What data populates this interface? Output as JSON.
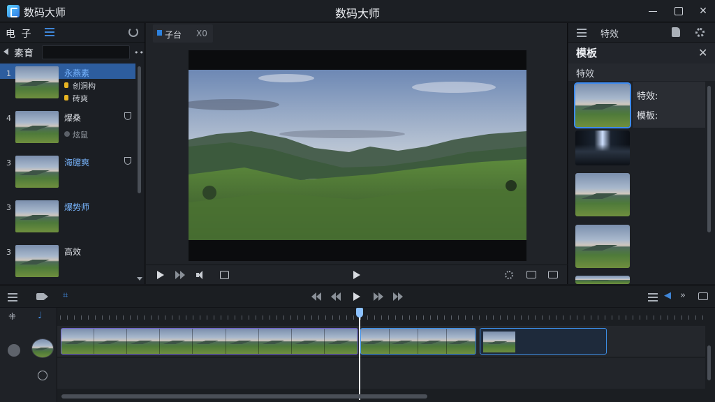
{
  "titlebar": {
    "app_name": "数码大师",
    "window_title": "数码大师"
  },
  "left_panel": {
    "tab_text": "电 子",
    "header_title": "素育",
    "items": [
      {
        "num": "1",
        "name": "永燕素",
        "sub1": "创洞构",
        "sub2": "砖爽",
        "active": true
      },
      {
        "num": "4",
        "name": "爆桑",
        "sub1": "炫鼠"
      },
      {
        "num": "3",
        "name": "海臆爽"
      },
      {
        "num": "3",
        "name": "爆势师"
      },
      {
        "num": "3",
        "name": "高效"
      }
    ]
  },
  "preview": {
    "tab_label": "子台",
    "tab_extra": "X0"
  },
  "right_panel": {
    "top_title": "特效",
    "head_title": "模板",
    "sub_title": "特效",
    "info_line1": "特效:",
    "info_line2": "模板:"
  },
  "colors": {
    "accent": "#3d8bf0",
    "selection": "#2d5d9e",
    "badge": "#e9b422"
  }
}
